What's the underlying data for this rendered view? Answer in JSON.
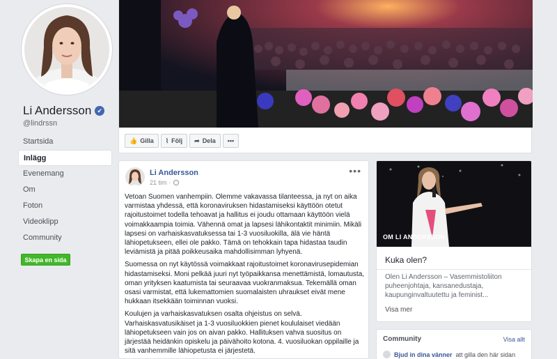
{
  "profile": {
    "name": "Li Andersson",
    "verified_mark": "✔",
    "handle": "@lindrssn"
  },
  "nav": {
    "items": [
      {
        "label": "Startsida",
        "active": false
      },
      {
        "label": "Inlägg",
        "active": true
      },
      {
        "label": "Evenemang",
        "active": false
      },
      {
        "label": "Om",
        "active": false
      },
      {
        "label": "Foton",
        "active": false
      },
      {
        "label": "Videoklipp",
        "active": false
      },
      {
        "label": "Community",
        "active": false
      }
    ],
    "create_page_label": "Skapa en sida"
  },
  "actions": {
    "like_label": "Gilla",
    "follow_label": "Följ",
    "share_label": "Dela",
    "more_label": "•••"
  },
  "post": {
    "author": "Li Andersson",
    "time": "21 tim",
    "more": "•••",
    "paragraphs": [
      "Vetoan Suomen vanhempiin. Olemme vakavassa tilanteessa, ja nyt on aika varmistaa yhdessä, että koronaviruksen hidastamiseksi käyttöön otetut rajoitustoimet todella tehoavat ja hallitus ei joudu ottamaan käyttöön vielä voimakkaampia toimia. Vähennä omat ja lapsesi lähikontaktit minimiin. Mikäli lapsesi on varhaiskasvatuksessa tai 1-3 vuosiluokilla, älä vie häntä lähiopetukseen, ellei ole pakko. Tämä on tehokkain tapa hidastaa taudin leviämistä ja pitää poikkeusaika mahdollisimman lyhyenä.",
      "Suomessa on nyt käytössä voimakkaat rajoitustoimet koronavirusepidemian hidastamiseksi. Moni pelkää juuri nyt työpaikkansa menettämistä, lomautusta, oman yrityksen kaatumista tai seuraavaa vuokranmaksua. Tekemällä oman osasi varmistat, että lukemattomien suomalaisten uhraukset eivät mene hukkaan itsekkään toiminnan vuoksi.",
      "Koulujen ja varhaiskasvatuksen osalta ohjeistus on selvä. Varhaiskasvatusikäiset ja 1-3 vuosiluokkien pienet koululaiset viedään lähiopetukseen vain jos on aivan pakko. Hallituksen vahva suositus on järjestää heidänkin opiskelu ja päivähoito kotona. 4. vuosiluokan oppilaille ja sitä vanhemmille lähiopetusta ei järjestetä."
    ]
  },
  "about": {
    "caption": "OM LI ANDERSSON",
    "title": "Kuka olen?",
    "text": "Olen Li Andersson – Vasemmistoliiton puheenjohtaja, kansanedustaja, kaupunginvaltuutettu ja feminist...",
    "link": "Visa mer"
  },
  "community": {
    "title": "Community",
    "see_all": "Visa allt",
    "invite_link": "Bjud in dina vänner",
    "invite_rest": "att gilla den här sidan"
  },
  "colors": {
    "accent": "#385898",
    "create_button": "#42b72a",
    "verified": "#4267b2"
  }
}
